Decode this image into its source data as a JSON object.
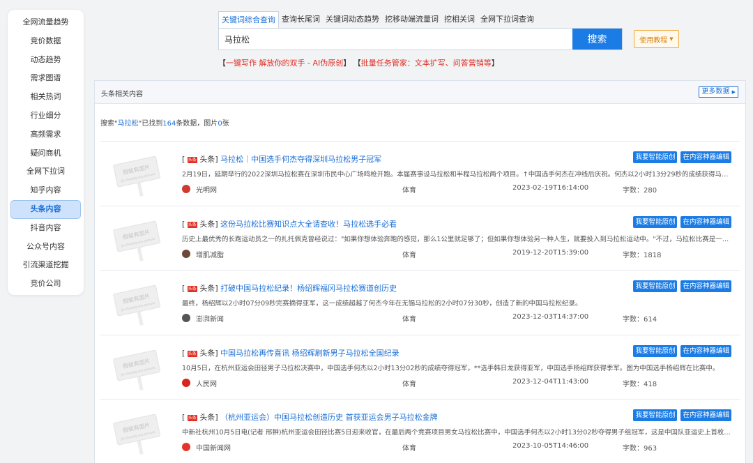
{
  "sidebar": {
    "items": [
      {
        "label": "全网流量趋势",
        "active": false
      },
      {
        "label": "竞价数据",
        "active": false
      },
      {
        "label": "动态趋势",
        "active": false
      },
      {
        "label": "需求图谱",
        "active": false
      },
      {
        "label": "相关热词",
        "active": false
      },
      {
        "label": "行业细分",
        "active": false
      },
      {
        "label": "高频需求",
        "active": false
      },
      {
        "label": "疑问商机",
        "active": false
      },
      {
        "label": "全网下拉词",
        "active": false
      },
      {
        "label": "知乎内容",
        "active": false
      },
      {
        "label": "头条内容",
        "active": true
      },
      {
        "label": "抖音内容",
        "active": false
      },
      {
        "label": "公众号内容",
        "active": false
      },
      {
        "label": "引流渠道挖掘",
        "active": false
      },
      {
        "label": "竞价公司",
        "active": false
      }
    ]
  },
  "search": {
    "tabs": [
      {
        "label": "关键词综合查询",
        "active": true
      },
      {
        "label": "查询长尾词",
        "active": false
      },
      {
        "label": "关键词动态趋势",
        "active": false
      },
      {
        "label": "挖移动端流量词",
        "active": false
      },
      {
        "label": "挖相关词",
        "active": false
      },
      {
        "label": "全网下拉词查询",
        "active": false
      }
    ],
    "value": "马拉松",
    "button_label": "搜索",
    "tutorial_label": "使用教程"
  },
  "promo": {
    "open1": "【",
    "link1": "一键写作 解放你的双手 - AI伪原创",
    "close1": "】",
    "open2": "【",
    "link2": "批量任务管家：文本扩写、问答营销等",
    "close2": "】"
  },
  "panel": {
    "title": "头条相关内容",
    "more_label": "更多数据",
    "summary": {
      "prefix": "搜索\"",
      "keyword": "马拉松",
      "mid": "\"已找到",
      "count": "164",
      "mid2": "条数据，图片",
      "images": "0",
      "suffix": "张"
    }
  },
  "thumb_text": {
    "line1": "假装有图片",
    "line2": "jia zhuang you picture"
  },
  "labels": {
    "toutiao_badge": "头条",
    "source": "头条",
    "btn_original": "我要智能原创",
    "btn_edit": "在内容神器编辑"
  },
  "results": [
    {
      "title": "马拉松｜中国选手何杰夺得深圳马拉松男子冠军",
      "summary": "2月19日，延期举行的2022深圳马拉松赛在深圳市民中心广场鸣枪开跑。本届赛事设马拉松和半程马拉松两个项目。↑中国选手何杰在冲线后庆祝。何杰以2小时13分29秒的成绩获得马拉松...",
      "media": "光明网",
      "media_color": "#cf3b2e",
      "category": "体育",
      "date": "2023-02-19T16:14:00",
      "words": "字数：280"
    },
    {
      "title": "这份马拉松比赛知识点大全请查收！马拉松选手必看",
      "summary": "历史上最优秀的长跑运动员之一的扎托佩克曾经说过：\"如果你想体验奔跑的感觉，那么1公里就足够了；但如果你想体验另一种人生，就要投入到马拉松运动中。\"不过，马拉松比赛是一项...",
      "media": "增肌减脂",
      "media_color": "#6b4a3a",
      "category": "体育",
      "date": "2019-12-20T15:39:00",
      "words": "字数：1818"
    },
    {
      "title": "打破中国马拉松纪录！杨绍辉福冈马拉松赛道创历史",
      "summary": "最终，杨绍辉以2小时07分09秒完赛摘得亚军，这一成绩超越了何杰今年在无锡马拉松的2小时07分30秒，创造了新的中国马拉松纪录。",
      "media": "澎湃新闻",
      "media_color": "#555555",
      "category": "体育",
      "date": "2023-12-03T14:37:00",
      "words": "字数：614"
    },
    {
      "title": "中国马拉松再传喜讯 杨绍辉刷新男子马拉松全国纪录",
      "summary": "10月5日，在杭州亚运会田径男子马拉松决赛中，中国选手何杰以2小时13分02秒的成绩夺得冠军，**选手韩日龙获得亚军，中国选手杨绍辉获得季军。图为中国选手杨绍辉在比赛中。",
      "media": "人民网",
      "media_color": "#d7261e",
      "category": "体育",
      "date": "2023-12-04T11:43:00",
      "words": "字数：418"
    },
    {
      "title": "（杭州亚运会）中国马拉松创造历史 首获亚运会男子马拉松金牌",
      "summary": "中新社杭州10月5日电(记者 邢翀)杭州亚运会田径比赛5日迎来收官，在最后两个竞赛项目男女马拉松比赛中，中国选手何杰以2小时13分02秒夺得男子组冠军，这是中国队亚运史上首枚男...",
      "media": "中国新闻网",
      "media_color": "#e4352b",
      "category": "体育",
      "date": "2023-10-05T14:46:00",
      "words": "字数：963"
    }
  ]
}
